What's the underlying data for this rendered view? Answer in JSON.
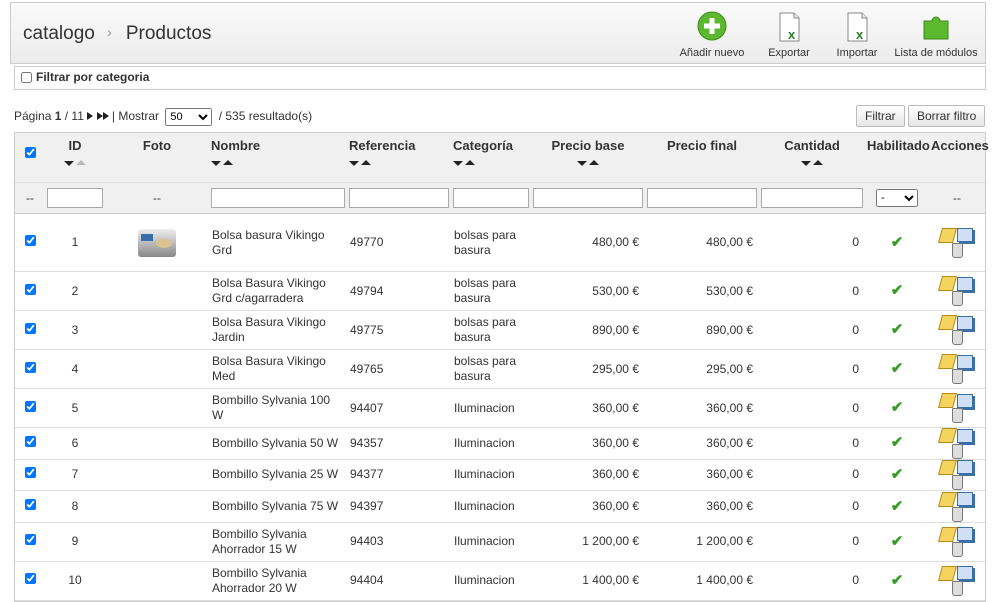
{
  "breadcrumb": {
    "root": "catalogo",
    "separator": "›",
    "current": "Productos"
  },
  "toolbar": [
    {
      "label": "Añadir nuevo",
      "icon": "add-circle-icon"
    },
    {
      "label": "Exportar",
      "icon": "excel-export-icon"
    },
    {
      "label": "Importar",
      "icon": "excel-import-icon"
    },
    {
      "label": "Lista de módulos",
      "icon": "puzzle-icon"
    }
  ],
  "category_filter": {
    "label": "Filtrar por categoria"
  },
  "pagination": {
    "prefix": "Página",
    "current": "1",
    "total": "/ 11",
    "show_label": "| Mostrar",
    "per_page": "50",
    "results": "/ 535 resultado(s)"
  },
  "buttons": {
    "filter": "Filtrar",
    "reset": "Borrar filtro"
  },
  "columns": {
    "id": "ID",
    "photo": "Foto",
    "name": "Nombre",
    "reference": "Referencia",
    "category": "Categoría",
    "base_price": "Precio base",
    "final_price": "Precio final",
    "quantity": "Cantidad",
    "enabled": "Habilitado",
    "actions": "Acciones"
  },
  "filter_row": {
    "dash": "--",
    "enabled_value": "-"
  },
  "rows": [
    {
      "id": "1",
      "name": "Bolsa basura Vikingo Grd",
      "ref": "49770",
      "cat": "bolsas para basura",
      "base": "480,00 €",
      "final": "480,00 €",
      "qty": "0",
      "has_photo": true
    },
    {
      "id": "2",
      "name": "Bolsa Basura Vikingo Grd c/agarradera",
      "ref": "49794",
      "cat": "bolsas para basura",
      "base": "530,00 €",
      "final": "530,00 €",
      "qty": "0"
    },
    {
      "id": "3",
      "name": "Bolsa Basura Vikingo Jardin",
      "ref": "49775",
      "cat": "bolsas para basura",
      "base": "890,00 €",
      "final": "890,00 €",
      "qty": "0"
    },
    {
      "id": "4",
      "name": "Bolsa Basura Vikingo Med",
      "ref": "49765",
      "cat": "bolsas para basura",
      "base": "295,00 €",
      "final": "295,00 €",
      "qty": "0"
    },
    {
      "id": "5",
      "name": "Bombillo Sylvania 100 W",
      "ref": "94407",
      "cat": "Iluminacion",
      "base": "360,00 €",
      "final": "360,00 €",
      "qty": "0"
    },
    {
      "id": "6",
      "name": "Bombillo Sylvania 50 W",
      "ref": "94357",
      "cat": "Iluminacion",
      "base": "360,00 €",
      "final": "360,00 €",
      "qty": "0"
    },
    {
      "id": "7",
      "name": "Bombillo Sylvania 25 W",
      "ref": "94377",
      "cat": "Iluminacion",
      "base": "360,00 €",
      "final": "360,00 €",
      "qty": "0"
    },
    {
      "id": "8",
      "name": "Bombillo Sylvania 75 W",
      "ref": "94397",
      "cat": "Iluminacion",
      "base": "360,00 €",
      "final": "360,00 €",
      "qty": "0"
    },
    {
      "id": "9",
      "name": "Bombillo Sylvania Ahorrador 15 W",
      "ref": "94403",
      "cat": "Iluminacion",
      "base": "1 200,00 €",
      "final": "1 200,00 €",
      "qty": "0"
    },
    {
      "id": "10",
      "name": "Bombillo Sylvania Ahorrador 20 W",
      "ref": "94404",
      "cat": "Iluminacion",
      "base": "1 400,00 €",
      "final": "1 400,00 €",
      "qty": "0"
    }
  ],
  "colors": {
    "accent_green": "#3a9a2a",
    "header_bg": "#f0f0f0",
    "border": "#cccccc"
  }
}
